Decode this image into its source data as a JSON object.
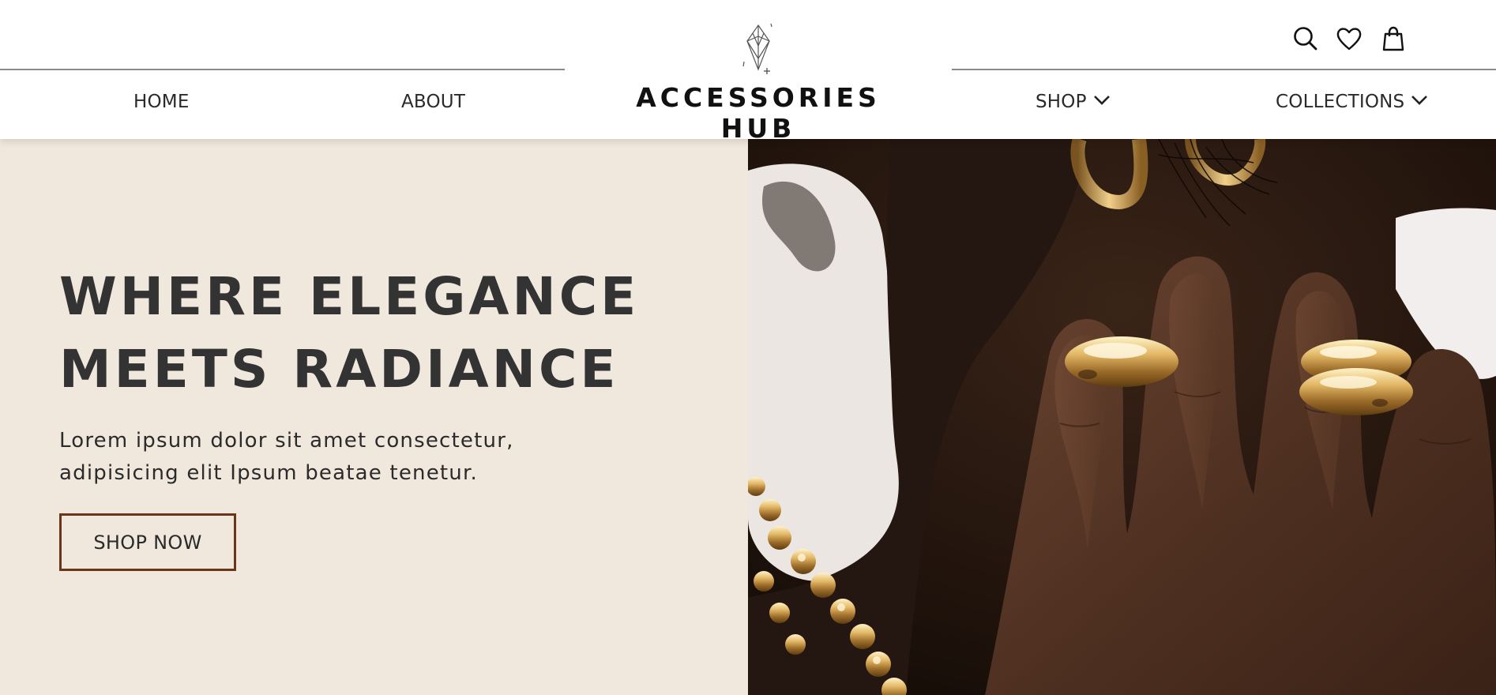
{
  "header": {
    "brand": "ACCESSORIES HUB",
    "logo_icon": "diamond-crystal-icon",
    "nav_left": [
      {
        "label": "HOME"
      },
      {
        "label": "ABOUT"
      }
    ],
    "nav_right": [
      {
        "label": "SHOP",
        "icon": "chevron-down-icon"
      },
      {
        "label": "COLLECTIONS",
        "icon": "chevron-down-icon"
      }
    ],
    "utility_icons": [
      "search-icon",
      "heart-icon",
      "shopping-bag-icon"
    ]
  },
  "hero": {
    "headline_line1": "WHERE ELEGANCE",
    "headline_line2": "MEETS RADIANCE",
    "body_line1": "Lorem ipsum dolor sit amet consectetur,",
    "body_line2": "adipisicing elit Ipsum beatae tenetur.",
    "cta_label": "SHOP NOW",
    "image_subject": "hand wearing gold dome rings"
  },
  "colors": {
    "hero_background": "#f0e7dd",
    "cta_border": "#6b3519",
    "headline_text": "#333333",
    "header_background": "#ffffff",
    "divider": "#8a8a8a"
  }
}
